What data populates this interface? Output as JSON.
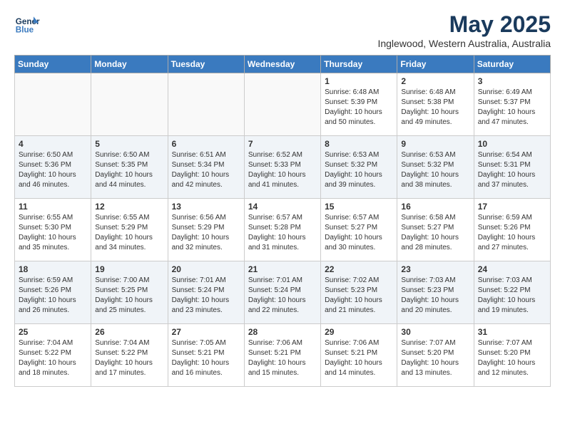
{
  "header": {
    "logo_line1": "General",
    "logo_line2": "Blue",
    "month": "May 2025",
    "location": "Inglewood, Western Australia, Australia"
  },
  "days_of_week": [
    "Sunday",
    "Monday",
    "Tuesday",
    "Wednesday",
    "Thursday",
    "Friday",
    "Saturday"
  ],
  "weeks": [
    [
      {
        "day": "",
        "info": ""
      },
      {
        "day": "",
        "info": ""
      },
      {
        "day": "",
        "info": ""
      },
      {
        "day": "",
        "info": ""
      },
      {
        "day": "1",
        "info": "Sunrise: 6:48 AM\nSunset: 5:39 PM\nDaylight: 10 hours\nand 50 minutes."
      },
      {
        "day": "2",
        "info": "Sunrise: 6:48 AM\nSunset: 5:38 PM\nDaylight: 10 hours\nand 49 minutes."
      },
      {
        "day": "3",
        "info": "Sunrise: 6:49 AM\nSunset: 5:37 PM\nDaylight: 10 hours\nand 47 minutes."
      }
    ],
    [
      {
        "day": "4",
        "info": "Sunrise: 6:50 AM\nSunset: 5:36 PM\nDaylight: 10 hours\nand 46 minutes."
      },
      {
        "day": "5",
        "info": "Sunrise: 6:50 AM\nSunset: 5:35 PM\nDaylight: 10 hours\nand 44 minutes."
      },
      {
        "day": "6",
        "info": "Sunrise: 6:51 AM\nSunset: 5:34 PM\nDaylight: 10 hours\nand 42 minutes."
      },
      {
        "day": "7",
        "info": "Sunrise: 6:52 AM\nSunset: 5:33 PM\nDaylight: 10 hours\nand 41 minutes."
      },
      {
        "day": "8",
        "info": "Sunrise: 6:53 AM\nSunset: 5:32 PM\nDaylight: 10 hours\nand 39 minutes."
      },
      {
        "day": "9",
        "info": "Sunrise: 6:53 AM\nSunset: 5:32 PM\nDaylight: 10 hours\nand 38 minutes."
      },
      {
        "day": "10",
        "info": "Sunrise: 6:54 AM\nSunset: 5:31 PM\nDaylight: 10 hours\nand 37 minutes."
      }
    ],
    [
      {
        "day": "11",
        "info": "Sunrise: 6:55 AM\nSunset: 5:30 PM\nDaylight: 10 hours\nand 35 minutes."
      },
      {
        "day": "12",
        "info": "Sunrise: 6:55 AM\nSunset: 5:29 PM\nDaylight: 10 hours\nand 34 minutes."
      },
      {
        "day": "13",
        "info": "Sunrise: 6:56 AM\nSunset: 5:29 PM\nDaylight: 10 hours\nand 32 minutes."
      },
      {
        "day": "14",
        "info": "Sunrise: 6:57 AM\nSunset: 5:28 PM\nDaylight: 10 hours\nand 31 minutes."
      },
      {
        "day": "15",
        "info": "Sunrise: 6:57 AM\nSunset: 5:27 PM\nDaylight: 10 hours\nand 30 minutes."
      },
      {
        "day": "16",
        "info": "Sunrise: 6:58 AM\nSunset: 5:27 PM\nDaylight: 10 hours\nand 28 minutes."
      },
      {
        "day": "17",
        "info": "Sunrise: 6:59 AM\nSunset: 5:26 PM\nDaylight: 10 hours\nand 27 minutes."
      }
    ],
    [
      {
        "day": "18",
        "info": "Sunrise: 6:59 AM\nSunset: 5:26 PM\nDaylight: 10 hours\nand 26 minutes."
      },
      {
        "day": "19",
        "info": "Sunrise: 7:00 AM\nSunset: 5:25 PM\nDaylight: 10 hours\nand 25 minutes."
      },
      {
        "day": "20",
        "info": "Sunrise: 7:01 AM\nSunset: 5:24 PM\nDaylight: 10 hours\nand 23 minutes."
      },
      {
        "day": "21",
        "info": "Sunrise: 7:01 AM\nSunset: 5:24 PM\nDaylight: 10 hours\nand 22 minutes."
      },
      {
        "day": "22",
        "info": "Sunrise: 7:02 AM\nSunset: 5:23 PM\nDaylight: 10 hours\nand 21 minutes."
      },
      {
        "day": "23",
        "info": "Sunrise: 7:03 AM\nSunset: 5:23 PM\nDaylight: 10 hours\nand 20 minutes."
      },
      {
        "day": "24",
        "info": "Sunrise: 7:03 AM\nSunset: 5:22 PM\nDaylight: 10 hours\nand 19 minutes."
      }
    ],
    [
      {
        "day": "25",
        "info": "Sunrise: 7:04 AM\nSunset: 5:22 PM\nDaylight: 10 hours\nand 18 minutes."
      },
      {
        "day": "26",
        "info": "Sunrise: 7:04 AM\nSunset: 5:22 PM\nDaylight: 10 hours\nand 17 minutes."
      },
      {
        "day": "27",
        "info": "Sunrise: 7:05 AM\nSunset: 5:21 PM\nDaylight: 10 hours\nand 16 minutes."
      },
      {
        "day": "28",
        "info": "Sunrise: 7:06 AM\nSunset: 5:21 PM\nDaylight: 10 hours\nand 15 minutes."
      },
      {
        "day": "29",
        "info": "Sunrise: 7:06 AM\nSunset: 5:21 PM\nDaylight: 10 hours\nand 14 minutes."
      },
      {
        "day": "30",
        "info": "Sunrise: 7:07 AM\nSunset: 5:20 PM\nDaylight: 10 hours\nand 13 minutes."
      },
      {
        "day": "31",
        "info": "Sunrise: 7:07 AM\nSunset: 5:20 PM\nDaylight: 10 hours\nand 12 minutes."
      }
    ]
  ]
}
